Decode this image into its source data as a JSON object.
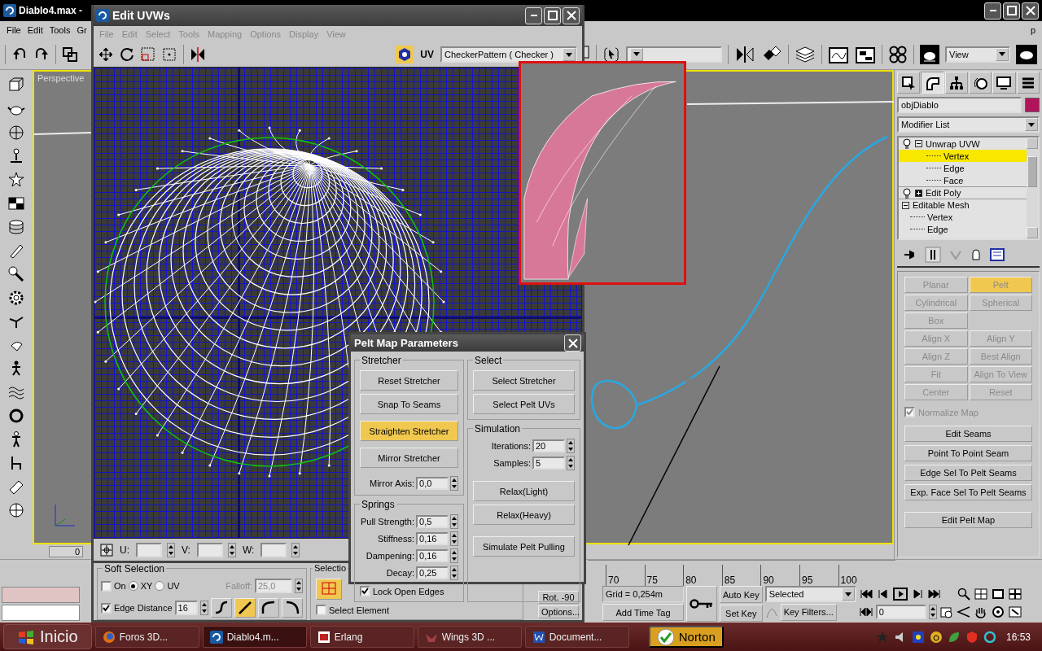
{
  "main_window": {
    "title": "Diablo4.max -",
    "menu": [
      "File",
      "Edit",
      "Tools",
      "Gr",
      "p"
    ],
    "view_dropdown": "View",
    "viewport_label": "Perspective",
    "time_slider": "0",
    "ruler": [
      "70",
      "75",
      "80",
      "85",
      "90",
      "95",
      "100"
    ]
  },
  "uv_editor": {
    "title": "Edit UVWs",
    "menu": [
      "File",
      "Edit",
      "Select",
      "Tools",
      "Mapping",
      "Options",
      "Display",
      "View"
    ],
    "uv_label": "UV",
    "texture": "CheckerPattern  ( Checker )",
    "coords": [
      {
        "label": "U:"
      },
      {
        "label": "V:"
      },
      {
        "label": "W:"
      }
    ],
    "soft_selection": {
      "title": "Soft Selection",
      "on": {
        "label": "On",
        "checked": false
      },
      "modes": [
        {
          "label": "XY",
          "selected": true
        },
        {
          "label": "UV",
          "selected": false
        }
      ],
      "falloff_label": "Falloff:",
      "falloff": "25,0",
      "edge_distance": {
        "label": "Edge Distance",
        "checked": true,
        "value": "16"
      },
      "curves": [
        {
          "kind": "s",
          "selected": false
        },
        {
          "kind": "linear",
          "selected": true
        },
        {
          "kind": "ease-out",
          "selected": false
        },
        {
          "kind": "ease-in",
          "selected": false
        }
      ]
    },
    "selection": {
      "title": "Selectio",
      "select_element": {
        "label": "Select Element",
        "checked": false
      }
    },
    "rot": "Rot. -90",
    "options": "Options..."
  },
  "pelt_dialog": {
    "title": "Pelt Map Parameters",
    "stretcher": {
      "title": "Stretcher",
      "buttons": [
        {
          "label": "Reset Stretcher",
          "selected": false
        },
        {
          "label": "Snap To Seams",
          "selected": false
        },
        {
          "label": "Straighten Stretcher",
          "selected": true
        },
        {
          "label": "Mirror Stretcher",
          "selected": false
        }
      ],
      "mirror_axis": {
        "label": "Mirror Axis:",
        "value": "0,0"
      }
    },
    "springs": {
      "title": "Springs",
      "fields": [
        {
          "label": "Pull Strength:",
          "value": "0,5"
        },
        {
          "label": "Stiffness:",
          "value": "0,16"
        },
        {
          "label": "Dampening:",
          "value": "0,16"
        },
        {
          "label": "Decay:",
          "value": "0,25"
        }
      ],
      "lock_open_edges": {
        "label": "Lock Open Edges",
        "checked": true
      }
    },
    "select": {
      "title": "Select",
      "buttons": [
        "Select Stretcher",
        "Select Pelt UVs"
      ]
    },
    "simulation": {
      "title": "Simulation",
      "fields": [
        {
          "label": "Iterations:",
          "value": "20"
        },
        {
          "label": "Samples:",
          "value": "5"
        }
      ],
      "buttons": [
        "Relax(Light)",
        "Relax(Heavy)",
        "Simulate Pelt Pulling"
      ]
    }
  },
  "command_panel": {
    "tabs": [
      {
        "kind": "create",
        "selected": false
      },
      {
        "kind": "modify",
        "selected": true
      },
      {
        "kind": "hierarchy",
        "selected": false
      },
      {
        "kind": "motion",
        "selected": false
      },
      {
        "kind": "display",
        "selected": false
      },
      {
        "kind": "utilities",
        "selected": false
      }
    ],
    "object_name": "objDiablo",
    "modifier_list": "Modifier List",
    "stack": [
      {
        "label": "Unwrap UVW",
        "kind": "modifier",
        "expanded": true,
        "selected": false,
        "children": [
          {
            "label": "Vertex",
            "selected": true
          },
          {
            "label": "Edge",
            "selected": false
          },
          {
            "label": "Face",
            "selected": false
          }
        ]
      },
      {
        "label": "Edit Poly",
        "kind": "modifier",
        "expanded": false,
        "selected": false
      },
      {
        "label": "Editable Mesh",
        "kind": "object",
        "expanded": true,
        "selected": false,
        "children": [
          {
            "label": "Vertex",
            "selected": false
          },
          {
            "label": "Edge",
            "selected": false
          }
        ]
      }
    ],
    "map_button_rows": [
      [
        {
          "label": "Planar",
          "selected": false,
          "disabled": true
        },
        {
          "label": "Pelt",
          "selected": true,
          "disabled": true
        }
      ],
      [
        {
          "label": "Cylindrical",
          "selected": false,
          "disabled": true
        },
        {
          "label": "Spherical",
          "selected": false,
          "disabled": true
        }
      ],
      [
        {
          "label": "Box",
          "selected": false,
          "disabled": true
        }
      ],
      [
        {
          "label": "Align X",
          "selected": false,
          "disabled": true
        },
        {
          "label": "Align Y",
          "selected": false,
          "disabled": true
        }
      ],
      [
        {
          "label": "Align Z",
          "selected": false,
          "disabled": true
        },
        {
          "label": "Best Align",
          "selected": false,
          "disabled": true
        }
      ],
      [
        {
          "label": "Fit",
          "selected": false,
          "disabled": true
        },
        {
          "label": "Align To View",
          "selected": false,
          "disabled": true
        }
      ],
      [
        {
          "label": "Center",
          "selected": false,
          "disabled": true
        },
        {
          "label": "Reset",
          "selected": false,
          "disabled": true
        }
      ]
    ],
    "normalize_map": {
      "label": "Normalize Map",
      "checked": true,
      "disabled": true
    },
    "seam_buttons": [
      "Edit Seams",
      "Point To Point Seam",
      "Edge Sel To Pelt Seams",
      "Exp. Face Sel To Pelt Seams"
    ],
    "edit_pelt_map": "Edit Pelt Map"
  },
  "animation": {
    "grid": "Grid = 0,254m",
    "time_tag": "Add Time Tag",
    "auto_key": "Auto Key",
    "set_key": "Set Key",
    "key_mode": "Selected",
    "key_filters": "Key Filters...",
    "frame": "0"
  },
  "taskbar": {
    "start": "Inicio",
    "tasks": [
      {
        "label": "Foros 3D...",
        "selected": false
      },
      {
        "label": "Diablo4.m...",
        "selected": true
      },
      {
        "label": "Erlang",
        "selected": false
      },
      {
        "label": "Wings 3D ...",
        "selected": false
      },
      {
        "label": "Document...",
        "selected": false
      }
    ],
    "tray": "Norton",
    "clock": "16:53"
  }
}
